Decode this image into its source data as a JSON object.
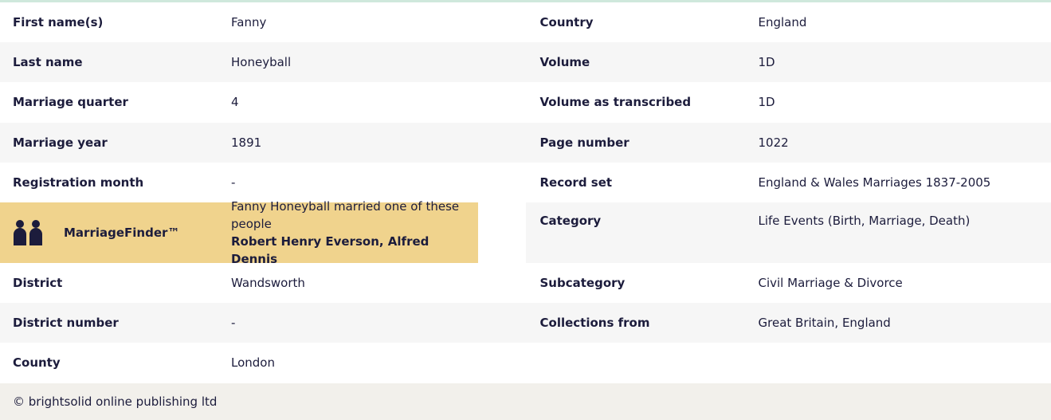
{
  "left": [
    {
      "label": "First name(s)",
      "value": "Fanny"
    },
    {
      "label": "Last name",
      "value": "Honeyball"
    },
    {
      "label": "Marriage quarter",
      "value": "4"
    },
    {
      "label": "Marriage year",
      "value": "1891"
    },
    {
      "label": "Registration month",
      "value": "-"
    },
    {
      "label": "District",
      "value": "Wandsworth"
    },
    {
      "label": "District number",
      "value": "-"
    },
    {
      "label": "County",
      "value": "London"
    }
  ],
  "marriage_finder": {
    "label": "MarriageFinder™",
    "intro": "Fanny Honeyball married one of these people",
    "names": "Robert Henry Everson, Alfred Dennis",
    "icon": "people-icon",
    "color": "#f0d38d"
  },
  "right": [
    {
      "label": "Country",
      "value": "England"
    },
    {
      "label": "Volume",
      "value": "1D"
    },
    {
      "label": "Volume as transcribed",
      "value": "1D"
    },
    {
      "label": "Page number",
      "value": "1022"
    },
    {
      "label": "Record set",
      "value": "England & Wales Marriages 1837-2005"
    },
    {
      "label": "Category",
      "value": "Life Events (Birth, Marriage, Death)"
    },
    {
      "label": "Subcategory",
      "value": "Civil Marriage & Divorce"
    },
    {
      "label": "Collections from",
      "value": "Great Britain, England"
    }
  ],
  "footer": {
    "copyright": "© brightsolid online publishing ltd"
  }
}
